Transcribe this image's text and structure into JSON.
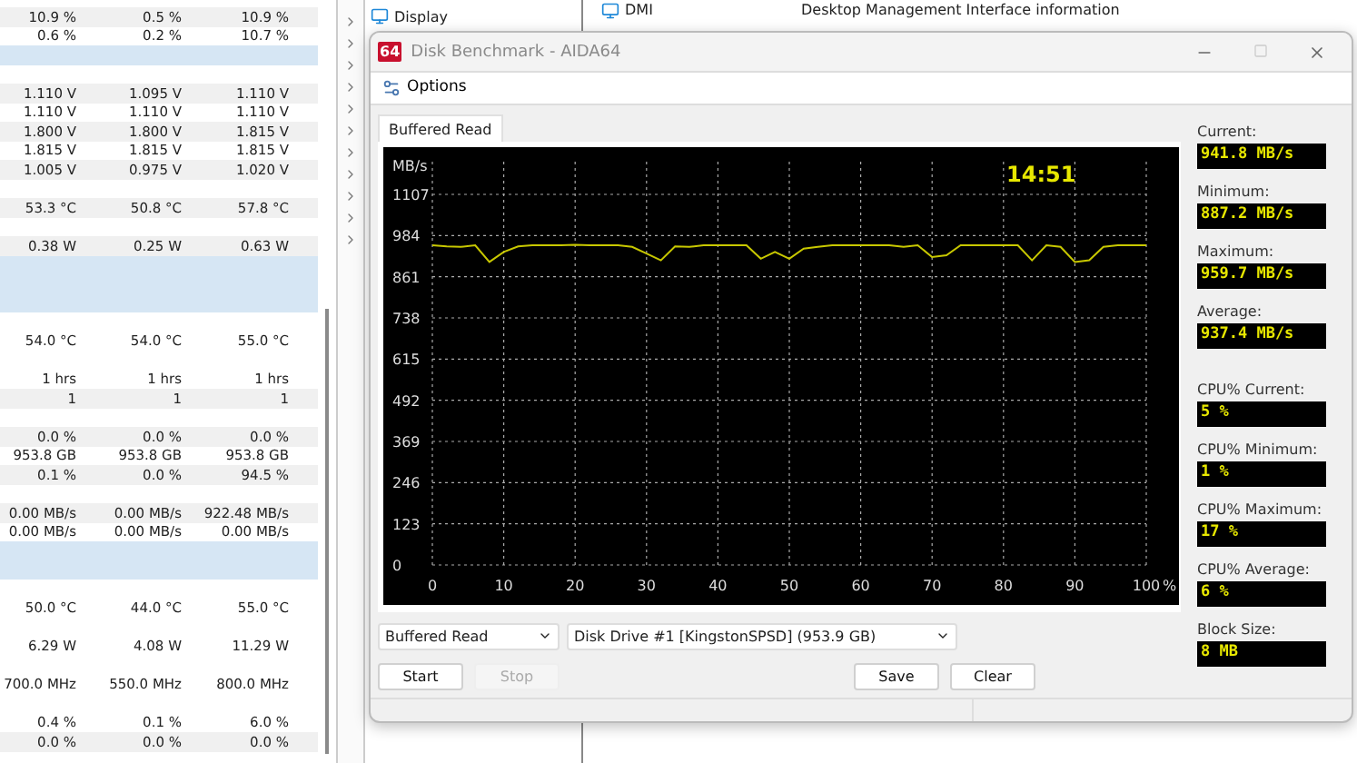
{
  "sensor_table": {
    "rows": [
      {
        "kind": "values",
        "cells": [
          "10.9 %",
          "0.5 %",
          "10.9 %"
        ]
      },
      {
        "kind": "values",
        "cells": [
          "0.6 %",
          "0.2 %",
          "10.7 %"
        ]
      },
      {
        "kind": "section"
      },
      {
        "kind": "blank"
      },
      {
        "kind": "values",
        "cells": [
          "1.110 V",
          "1.095 V",
          "1.110 V"
        ]
      },
      {
        "kind": "values",
        "cells": [
          "1.110 V",
          "1.110 V",
          "1.110 V"
        ]
      },
      {
        "kind": "values",
        "cells": [
          "1.800 V",
          "1.800 V",
          "1.815 V"
        ]
      },
      {
        "kind": "values",
        "cells": [
          "1.815 V",
          "1.815 V",
          "1.815 V"
        ]
      },
      {
        "kind": "values",
        "cells": [
          "1.005 V",
          "0.975 V",
          "1.020 V"
        ]
      },
      {
        "kind": "blank"
      },
      {
        "kind": "values",
        "cells": [
          "53.3 °C",
          "50.8 °C",
          "57.8 °C"
        ]
      },
      {
        "kind": "blank"
      },
      {
        "kind": "values",
        "cells": [
          "0.38 W",
          "0.25 W",
          "0.63 W"
        ]
      },
      {
        "kind": "section"
      },
      {
        "kind": "section"
      },
      {
        "kind": "section"
      },
      {
        "kind": "blank"
      },
      {
        "kind": "values",
        "cells": [
          "54.0 °C",
          "54.0 °C",
          "55.0 °C"
        ]
      },
      {
        "kind": "blank"
      },
      {
        "kind": "values",
        "cells": [
          "1 hrs",
          "1 hrs",
          "1 hrs"
        ]
      },
      {
        "kind": "values",
        "cells": [
          "1",
          "1",
          "1"
        ]
      },
      {
        "kind": "blank"
      },
      {
        "kind": "values",
        "cells": [
          "0.0 %",
          "0.0 %",
          "0.0 %"
        ]
      },
      {
        "kind": "values",
        "cells": [
          "953.8 GB",
          "953.8 GB",
          "953.8 GB"
        ]
      },
      {
        "kind": "values",
        "cells": [
          "0.1 %",
          "0.0 %",
          "94.5 %"
        ]
      },
      {
        "kind": "blank"
      },
      {
        "kind": "values",
        "cells": [
          "0.00 MB/s",
          "0.00 MB/s",
          "922.48 MB/s"
        ]
      },
      {
        "kind": "values",
        "cells": [
          "0.00 MB/s",
          "0.00 MB/s",
          "0.00 MB/s"
        ]
      },
      {
        "kind": "section"
      },
      {
        "kind": "section"
      },
      {
        "kind": "blank"
      },
      {
        "kind": "values",
        "cells": [
          "50.0 °C",
          "44.0 °C",
          "55.0 °C"
        ]
      },
      {
        "kind": "blank"
      },
      {
        "kind": "values",
        "cells": [
          "6.29 W",
          "4.08 W",
          "11.29 W"
        ]
      },
      {
        "kind": "blank"
      },
      {
        "kind": "values",
        "cells": [
          "700.0 MHz",
          "550.0 MHz",
          "800.0 MHz"
        ]
      },
      {
        "kind": "blank"
      },
      {
        "kind": "values",
        "cells": [
          "0.4 %",
          "0.1 %",
          "6.0 %"
        ]
      },
      {
        "kind": "values",
        "cells": [
          "0.0 %",
          "0.0 %",
          "0.0 %"
        ]
      }
    ]
  },
  "tree": {
    "items": [
      {
        "label": "Display"
      }
    ]
  },
  "device_list": {
    "rows": [
      {
        "name": "DMI",
        "description": "Desktop Management Interface information"
      }
    ]
  },
  "dialog": {
    "title": "Disk Benchmark - AIDA64",
    "app_badge": "64",
    "toolbar": {
      "options": "Options"
    },
    "tab": {
      "label": "Buffered Read",
      "selected": true
    },
    "chart_data": {
      "type": "line",
      "ylabel": "MB/s",
      "xlabel": "%",
      "xlim": [
        0,
        100
      ],
      "ylim": [
        0,
        1107
      ],
      "xticks": [
        0,
        10,
        20,
        30,
        40,
        50,
        60,
        70,
        80,
        90,
        100
      ],
      "yticks": [
        0,
        123,
        246,
        369,
        492,
        615,
        738,
        861,
        984,
        1107
      ],
      "x": [
        0,
        2,
        4,
        6,
        8,
        10,
        12,
        14,
        16,
        18,
        20,
        22,
        24,
        26,
        28,
        30,
        32,
        34,
        36,
        38,
        40,
        42,
        44,
        46,
        48,
        50,
        52,
        54,
        56,
        58,
        60,
        62,
        64,
        66,
        68,
        70,
        72,
        74,
        76,
        78,
        80,
        82,
        84,
        86,
        88,
        90,
        92,
        94,
        96,
        98,
        100
      ],
      "grid": true,
      "series": [
        {
          "color": "#c8c800",
          "values": [
            955,
            952,
            950,
            955,
            905,
            935,
            952,
            955,
            955,
            955,
            956,
            955,
            955,
            955,
            950,
            930,
            910,
            952,
            950,
            955,
            955,
            955,
            955,
            915,
            935,
            915,
            945,
            950,
            955,
            955,
            955,
            955,
            955,
            950,
            955,
            920,
            925,
            955,
            955,
            955,
            955,
            955,
            910,
            955,
            950,
            905,
            910,
            950,
            955,
            955,
            955
          ]
        }
      ],
      "annotations": [
        {
          "text": "14:51"
        }
      ]
    },
    "stats": [
      {
        "kind": "speed",
        "label": "Current:",
        "value": "941.8 MB/s"
      },
      {
        "kind": "speed",
        "label": "Minimum:",
        "value": "887.2 MB/s"
      },
      {
        "kind": "speed",
        "label": "Maximum:",
        "value": "959.7 MB/s"
      },
      {
        "kind": "speed",
        "label": "Average:",
        "value": "937.4 MB/s"
      },
      {
        "kind": "cpu",
        "label": "CPU% Current:",
        "value": "5 %"
      },
      {
        "kind": "cpu",
        "label": "CPU% Minimum:",
        "value": "1 %"
      },
      {
        "kind": "cpu",
        "label": "CPU% Maximum:",
        "value": "17 %"
      },
      {
        "kind": "cpu",
        "label": "CPU% Average:",
        "value": "6 %"
      },
      {
        "kind": "block",
        "label": "Block Size:",
        "value": "8 MB"
      }
    ],
    "test_select": {
      "value": "Buffered Read"
    },
    "drive_select": {
      "value": "Disk Drive #1  [KingstonSPSD]  (953.9 GB)"
    },
    "left_buttons": [
      {
        "label": "Start",
        "disabled": false
      },
      {
        "label": "Stop",
        "disabled": true
      }
    ],
    "right_buttons": [
      {
        "label": "Save",
        "disabled": false
      },
      {
        "label": "Clear",
        "disabled": false
      }
    ]
  }
}
